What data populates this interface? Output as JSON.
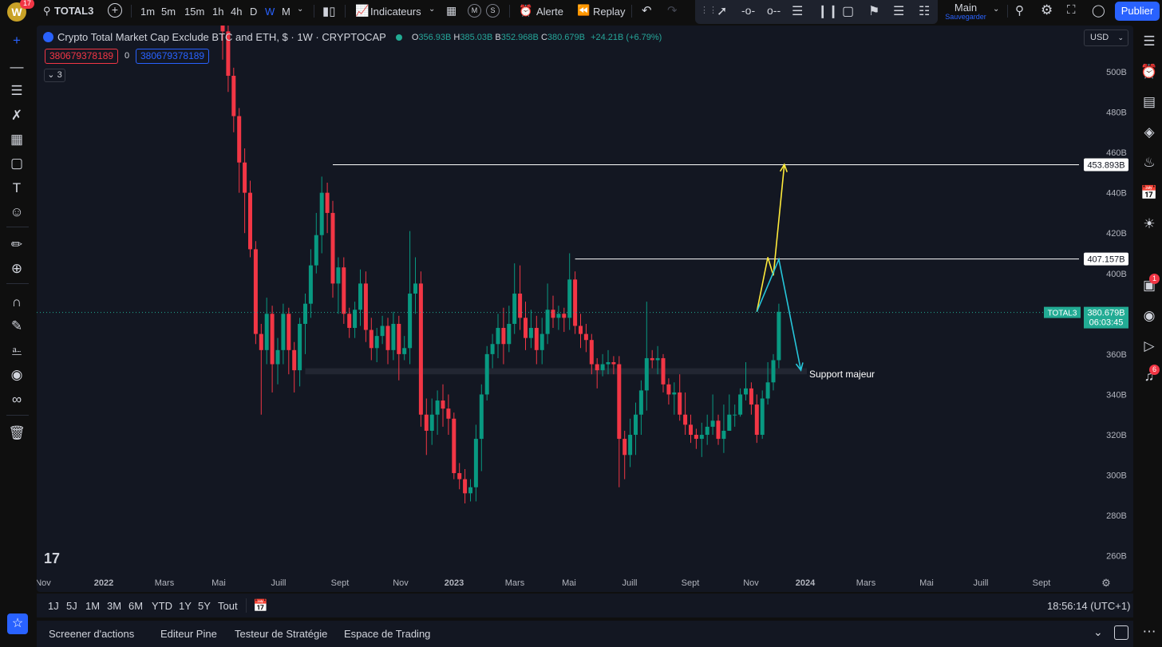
{
  "topbar": {
    "avatar_letter": "W",
    "notifications": "17",
    "symbol": "TOTAL3",
    "intervals": [
      "1m",
      "5m",
      "15m",
      "1h",
      "4h",
      "D",
      "W",
      "M"
    ],
    "active_interval": "W",
    "indicators_label": "Indicateurs",
    "alert_label": "Alerte",
    "replay_label": "Replay",
    "layout_name": "Main",
    "layout_status": "Sauvegarder",
    "publish_label": "Publier"
  },
  "chart_header": {
    "title": "Crypto Total Market Cap Exclude BTC and ETH, $ · 1W · CRYPTOCAP",
    "open_label": "O",
    "open": "356.93B",
    "high_label": "H",
    "high": "385.03B",
    "low_label": "B",
    "low": "352.968B",
    "close_label": "C",
    "close": "380.679B",
    "change": "+24.21B (+6.79%)",
    "sell_value": "380679378189",
    "spread": "0",
    "buy_value": "380679378189",
    "indicators_count": "3",
    "currency": "USD"
  },
  "chart_data": {
    "type": "candlestick",
    "title": "Crypto Total Market Cap Exclude BTC and ETH, $ · 1W · CRYPTOCAP",
    "ylim": [
      250,
      515
    ],
    "y_ticks": [
      260,
      280,
      300,
      320,
      340,
      360,
      380,
      400,
      420,
      440,
      460,
      480,
      500
    ],
    "y_tick_labels": [
      "260B",
      "280B",
      "300B",
      "320B",
      "340B",
      "360B",
      "380B",
      "400B",
      "420B",
      "440B",
      "460B",
      "480B",
      "500B"
    ],
    "x_tick_labels": [
      "Nov",
      "2022",
      "Mars",
      "Mai",
      "Juill",
      "Sept",
      "Nov",
      "2023",
      "Mars",
      "Mai",
      "Juill",
      "Sept",
      "Nov",
      "2024",
      "Mars",
      "Mai",
      "Juill",
      "Sept"
    ],
    "up_color": "#089981",
    "down_color": "#f23645",
    "candles": [
      [
        530,
        520,
        540,
        506
      ],
      [
        520,
        498,
        524,
        490
      ],
      [
        498,
        478,
        502,
        470
      ],
      [
        478,
        455,
        482,
        440
      ],
      [
        455,
        440,
        462,
        420
      ],
      [
        440,
        412,
        446,
        408
      ],
      [
        412,
        370,
        416,
        365
      ],
      [
        370,
        362,
        375,
        330
      ],
      [
        362,
        380,
        388,
        355
      ],
      [
        380,
        355,
        384,
        341
      ],
      [
        355,
        362,
        368,
        345
      ],
      [
        362,
        380,
        385,
        355
      ],
      [
        380,
        362,
        383,
        350
      ],
      [
        362,
        352,
        366,
        341
      ],
      [
        352,
        375,
        378,
        344
      ],
      [
        375,
        385,
        390,
        360
      ],
      [
        385,
        404,
        412,
        378
      ],
      [
        404,
        419,
        430,
        400
      ],
      [
        419,
        440,
        448,
        410
      ],
      [
        440,
        430,
        445,
        420
      ],
      [
        430,
        395,
        436,
        388
      ],
      [
        395,
        403,
        408,
        380
      ],
      [
        403,
        380,
        408,
        375
      ],
      [
        380,
        373,
        383,
        368
      ],
      [
        373,
        382,
        386,
        368
      ],
      [
        382,
        395,
        402,
        374
      ],
      [
        395,
        372,
        401,
        366
      ],
      [
        372,
        363,
        378,
        357
      ],
      [
        363,
        369,
        373,
        356
      ],
      [
        369,
        374,
        379,
        365
      ],
      [
        374,
        362,
        378,
        355
      ],
      [
        362,
        375,
        381,
        357
      ],
      [
        375,
        360,
        379,
        347
      ],
      [
        360,
        363,
        369,
        357
      ],
      [
        363,
        390,
        421,
        355
      ],
      [
        390,
        395,
        408,
        380
      ],
      [
        395,
        330,
        401,
        324
      ],
      [
        330,
        322,
        338,
        310
      ],
      [
        322,
        330,
        338,
        315
      ],
      [
        330,
        337,
        342,
        320
      ],
      [
        337,
        333,
        345,
        324
      ],
      [
        333,
        328,
        340,
        320
      ],
      [
        328,
        301,
        331,
        298
      ],
      [
        301,
        298,
        306,
        293
      ],
      [
        298,
        291,
        303,
        286
      ],
      [
        291,
        294,
        298,
        287
      ],
      [
        294,
        318,
        325,
        287
      ],
      [
        318,
        340,
        345,
        302
      ],
      [
        340,
        360,
        364,
        337
      ],
      [
        360,
        365,
        370,
        353
      ],
      [
        365,
        373,
        380,
        358
      ],
      [
        373,
        365,
        383,
        355
      ],
      [
        365,
        375,
        384,
        361
      ],
      [
        375,
        390,
        405,
        370
      ],
      [
        390,
        378,
        404,
        372
      ],
      [
        378,
        368,
        386,
        362
      ],
      [
        368,
        373,
        382,
        363
      ],
      [
        373,
        362,
        379,
        355
      ],
      [
        362,
        370,
        378,
        355
      ],
      [
        370,
        382,
        395,
        365
      ],
      [
        382,
        378,
        389,
        373
      ],
      [
        378,
        380,
        384,
        372
      ],
      [
        380,
        378,
        383,
        371
      ],
      [
        378,
        397,
        410,
        372
      ],
      [
        397,
        374,
        401,
        370
      ],
      [
        374,
        370,
        380,
        363
      ],
      [
        370,
        367,
        375,
        361
      ],
      [
        367,
        355,
        370,
        350
      ],
      [
        355,
        352,
        358,
        343
      ],
      [
        352,
        355,
        360,
        349
      ],
      [
        355,
        356,
        362,
        350
      ],
      [
        356,
        355,
        359,
        350
      ],
      [
        355,
        318,
        359,
        294
      ],
      [
        318,
        310,
        322,
        298
      ],
      [
        310,
        320,
        328,
        304
      ],
      [
        320,
        330,
        336,
        310
      ],
      [
        330,
        342,
        347,
        320
      ],
      [
        342,
        358,
        386,
        332
      ],
      [
        358,
        357,
        362,
        353
      ],
      [
        357,
        358,
        364,
        350
      ],
      [
        358,
        345,
        360,
        341
      ],
      [
        345,
        340,
        348,
        335
      ],
      [
        340,
        341,
        346,
        330
      ],
      [
        341,
        330,
        350,
        327
      ],
      [
        330,
        325,
        341,
        320
      ],
      [
        325,
        320,
        330,
        316
      ],
      [
        320,
        318,
        323,
        313
      ],
      [
        318,
        320,
        326,
        309
      ],
      [
        320,
        324,
        330,
        315
      ],
      [
        324,
        327,
        340,
        320
      ],
      [
        327,
        318,
        330,
        315
      ],
      [
        318,
        322,
        335,
        311
      ],
      [
        322,
        330,
        340,
        322
      ],
      [
        330,
        330,
        335,
        324
      ],
      [
        330,
        340,
        343,
        329
      ],
      [
        340,
        343,
        356,
        337
      ],
      [
        343,
        335,
        346,
        330
      ],
      [
        335,
        320,
        340,
        316
      ],
      [
        320,
        338,
        342,
        318
      ],
      [
        338,
        346,
        356,
        335
      ],
      [
        346,
        357,
        360,
        342
      ],
      [
        357,
        381,
        385,
        353
      ]
    ],
    "horizontal_levels": [
      {
        "value": 453.893,
        "label": "453.893B"
      },
      {
        "value": 407.157,
        "label": "407.157B"
      }
    ],
    "current_price": {
      "symbol": "TOTAL3",
      "value": 380.679,
      "label": "380.679B",
      "countdown": "06:03:45"
    },
    "support_label": "Support majeur",
    "support_zone": [
      350,
      353
    ],
    "paths": [
      {
        "color": "#ffeb3b",
        "points": [
          [
            97,
            381
          ],
          [
            99,
            408
          ],
          [
            100,
            399
          ],
          [
            102,
            454
          ]
        ]
      },
      {
        "color": "#26c6da",
        "points": [
          [
            97,
            381
          ],
          [
            101,
            407
          ],
          [
            105,
            352
          ]
        ]
      }
    ]
  },
  "bottombar": {
    "ranges": [
      "1J",
      "5J",
      "1M",
      "3M",
      "6M",
      "YTD",
      "1Y",
      "5Y",
      "Tout"
    ],
    "time": "18:56:14 (UTC+1)"
  },
  "panel_tabs": [
    "Screener d'actions",
    "Editeur Pine",
    "Testeur de Stratégie",
    "Espace de Trading"
  ],
  "right_badges": {
    "chat": "1",
    "alerts": "6"
  }
}
